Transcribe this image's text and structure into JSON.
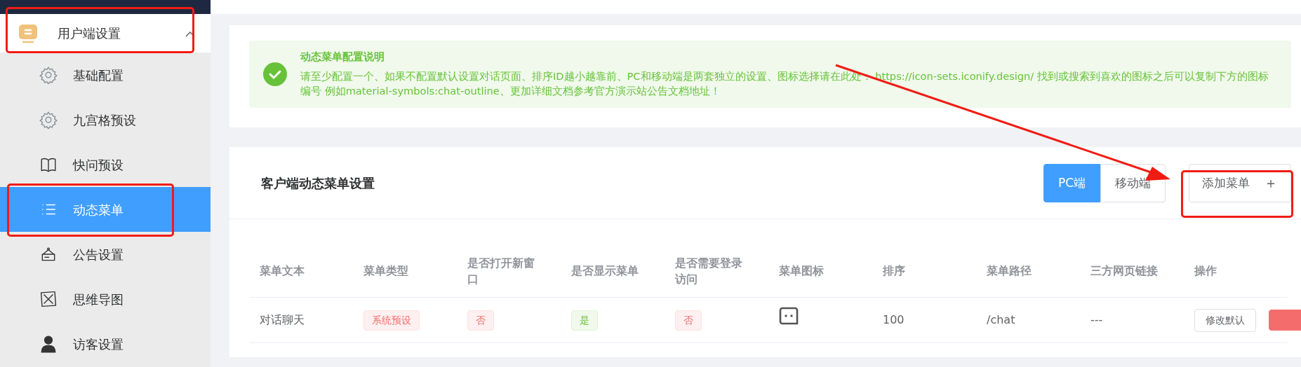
{
  "sidebar": {
    "group": {
      "label": "用户端设置",
      "expanded": true
    },
    "items": [
      {
        "label": "基础配置",
        "selected": false
      },
      {
        "label": "九宫格预设",
        "selected": false
      },
      {
        "label": "快问预设",
        "selected": false
      },
      {
        "label": "动态菜单",
        "selected": true
      },
      {
        "label": "公告设置",
        "selected": false
      },
      {
        "label": "思维导图",
        "selected": false
      },
      {
        "label": "访客设置",
        "selected": false
      }
    ]
  },
  "notice": {
    "title": "动态菜单配置说明",
    "text": "请至少配置一个、如果不配置默认设置对话页面、排序ID越小越靠前、PC和移动端是两套独立的设置、图标选择请在此处： https://icon-sets.iconify.design/ 找到或搜索到喜欢的图标之后可以复制下方的图标编号 例如material-symbols:chat-outline、更加详细文档参考官方演示站公告文档地址！"
  },
  "panel": {
    "title": "客户端动态菜单设置",
    "tabs": [
      {
        "label": "PC端",
        "selected": true
      },
      {
        "label": "移动端",
        "selected": false
      }
    ],
    "add_button": {
      "label": "添加菜单",
      "icon": "＋"
    }
  },
  "table": {
    "columns": [
      "菜单文本",
      "菜单类型",
      "是否打开新窗口",
      "是否显示菜单",
      "是否需要登录访问",
      "菜单图标",
      "排序",
      "菜单路径",
      "三方网页链接",
      "操作"
    ],
    "rows": [
      {
        "cells": [
          {
            "kind": "text",
            "text": "对话聊天"
          },
          {
            "kind": "redtag",
            "text": "系统预设"
          },
          {
            "kind": "redtag",
            "text": "否"
          },
          {
            "kind": "greentag",
            "text": "是"
          },
          {
            "kind": "redtag",
            "text": "否"
          },
          {
            "kind": "icon"
          },
          {
            "kind": "text",
            "text": "100"
          },
          {
            "kind": "text",
            "text": "/chat"
          },
          {
            "kind": "text",
            "text": "---"
          },
          {
            "kind": "actions",
            "buttons": [
              {
                "label": "修改默认",
                "kind": "outline"
              },
              {
                "kind": "filled"
              }
            ]
          }
        ]
      }
    ]
  }
}
